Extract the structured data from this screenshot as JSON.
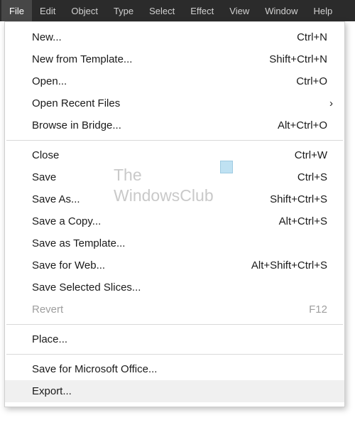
{
  "menubar": {
    "items": [
      {
        "label": "File",
        "active": true
      },
      {
        "label": "Edit",
        "active": false
      },
      {
        "label": "Object",
        "active": false
      },
      {
        "label": "Type",
        "active": false
      },
      {
        "label": "Select",
        "active": false
      },
      {
        "label": "Effect",
        "active": false
      },
      {
        "label": "View",
        "active": false
      },
      {
        "label": "Window",
        "active": false
      },
      {
        "label": "Help",
        "active": false
      }
    ]
  },
  "dropdown": {
    "items": [
      {
        "label": "New...",
        "shortcut": "Ctrl+N"
      },
      {
        "label": "New from Template...",
        "shortcut": "Shift+Ctrl+N"
      },
      {
        "label": "Open...",
        "shortcut": "Ctrl+O"
      },
      {
        "label": "Open Recent Files",
        "submenu": true
      },
      {
        "label": "Browse in Bridge...",
        "shortcut": "Alt+Ctrl+O"
      },
      {
        "sep": true
      },
      {
        "label": "Close",
        "shortcut": "Ctrl+W"
      },
      {
        "label": "Save",
        "shortcut": "Ctrl+S"
      },
      {
        "label": "Save As...",
        "shortcut": "Shift+Ctrl+S"
      },
      {
        "label": "Save a Copy...",
        "shortcut": "Alt+Ctrl+S"
      },
      {
        "label": "Save as Template..."
      },
      {
        "label": "Save for Web...",
        "shortcut": "Alt+Shift+Ctrl+S"
      },
      {
        "label": "Save Selected Slices..."
      },
      {
        "label": "Revert",
        "shortcut": "F12",
        "disabled": true
      },
      {
        "sep": true
      },
      {
        "label": "Place..."
      },
      {
        "sep": true
      },
      {
        "label": "Save for Microsoft Office..."
      },
      {
        "label": "Export...",
        "hover": true
      }
    ]
  },
  "watermark": {
    "line1": "The",
    "line2": "WindowsClub"
  }
}
